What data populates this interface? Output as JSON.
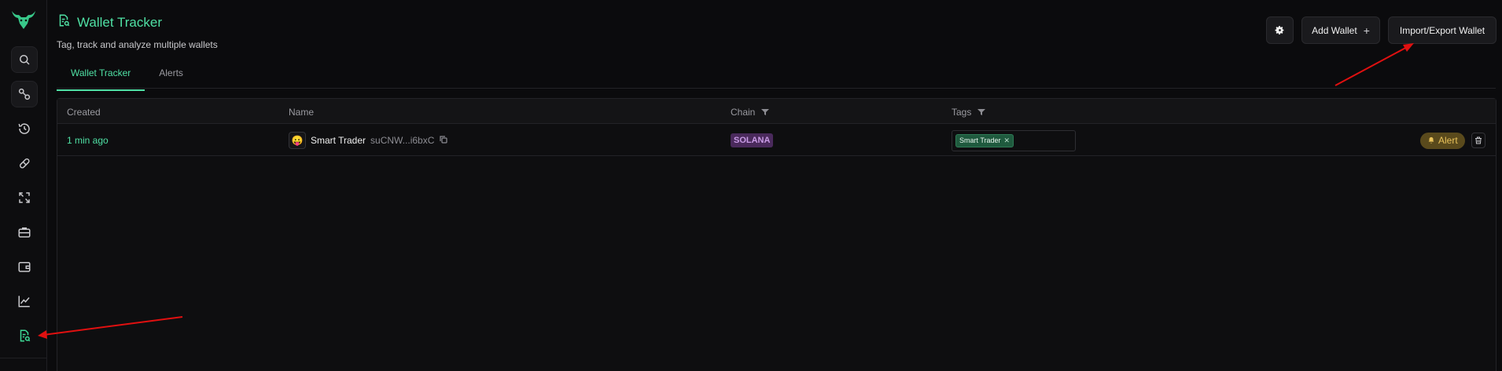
{
  "header": {
    "title": "Wallet Tracker",
    "subtitle": "Tag, track and analyze multiple wallets",
    "add_wallet_label": "Add Wallet",
    "import_export_label": "Import/Export Wallet"
  },
  "tabs": [
    {
      "label": "Wallet Tracker",
      "active": true
    },
    {
      "label": "Alerts",
      "active": false
    }
  ],
  "table": {
    "columns": {
      "created": "Created",
      "name": "Name",
      "chain": "Chain",
      "tags": "Tags"
    },
    "rows": [
      {
        "created": "1 min ago",
        "emoji": "😛",
        "name": "Smart Trader",
        "address": "suCNW...i6bxC",
        "chain": "SOLANA",
        "tags": [
          "Smart Trader"
        ],
        "alert_label": "Alert"
      }
    ]
  },
  "sidebar": {
    "items": [
      {
        "icon": "search-icon"
      },
      {
        "icon": "link-icon"
      },
      {
        "icon": "history-icon"
      },
      {
        "icon": "pill-icon"
      },
      {
        "icon": "swap-icon"
      },
      {
        "icon": "briefcase-icon"
      },
      {
        "icon": "wallet-icon"
      },
      {
        "icon": "chart-icon"
      },
      {
        "icon": "wallet-tracker-icon",
        "active": true
      }
    ]
  },
  "colors": {
    "accent": "#4fe0a4",
    "background": "#0b0b0d",
    "chain_badge": "#4a2a5c",
    "tag_chip": "#1f5a3e",
    "alert": "#5a4a1c",
    "annotation_arrow": "#e01010"
  }
}
